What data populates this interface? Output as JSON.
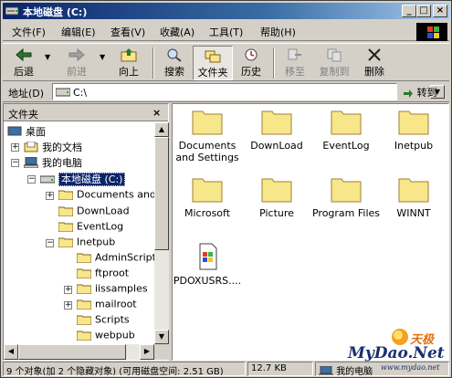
{
  "window": {
    "title": "本地磁盘 (C:)"
  },
  "title_buttons": {
    "minimize": "_",
    "maximize": "□",
    "close": "×"
  },
  "menu": [
    "文件(F)",
    "编辑(E)",
    "查看(V)",
    "收藏(A)",
    "工具(T)",
    "帮助(H)"
  ],
  "toolbar": {
    "back": "后退",
    "forward": "前进",
    "up": "向上",
    "search": "搜索",
    "folders": "文件夹",
    "history": "历史",
    "move_to": "移至",
    "copy_to": "复制到",
    "delete": "删除"
  },
  "address": {
    "label": "地址(D)",
    "value": "C:\\",
    "go": "转到"
  },
  "folder_pane": {
    "title": "文件夹",
    "close": "×",
    "tree": [
      {
        "label": "桌面"
      },
      {
        "label": "我的文档"
      },
      {
        "label": "我的电脑"
      },
      {
        "label": "本地磁盘 (C:)"
      },
      {
        "label": "Documents and S"
      },
      {
        "label": "DownLoad"
      },
      {
        "label": "EventLog"
      },
      {
        "label": "Inetpub"
      },
      {
        "label": "AdminScripts"
      },
      {
        "label": "ftproot"
      },
      {
        "label": "iissamples"
      },
      {
        "label": "mailroot"
      },
      {
        "label": "Scripts"
      },
      {
        "label": "webpub"
      }
    ]
  },
  "files": [
    {
      "name": "Documents and Settings"
    },
    {
      "name": "DownLoad"
    },
    {
      "name": "EventLog"
    },
    {
      "name": "Inetpub"
    },
    {
      "name": "Microsoft"
    },
    {
      "name": "Picture"
    },
    {
      "name": "Program Files"
    },
    {
      "name": "WINNT"
    },
    {
      "name": "PDOXUSRS...."
    }
  ],
  "status": {
    "objects": "9 个对象(加 2 个隐藏对象) (可用磁盘空间: 2.51 GB)",
    "size": "12.7 KB",
    "location": "我的电脑"
  },
  "watermark": {
    "brand": "天极",
    "site": "MyDao.Net",
    "url": "www.mydao.net"
  },
  "colors": {
    "titlebar": "#0a246a",
    "face": "#d4d0c8",
    "folder": "#f8e68a",
    "selection": "#0a246a"
  }
}
